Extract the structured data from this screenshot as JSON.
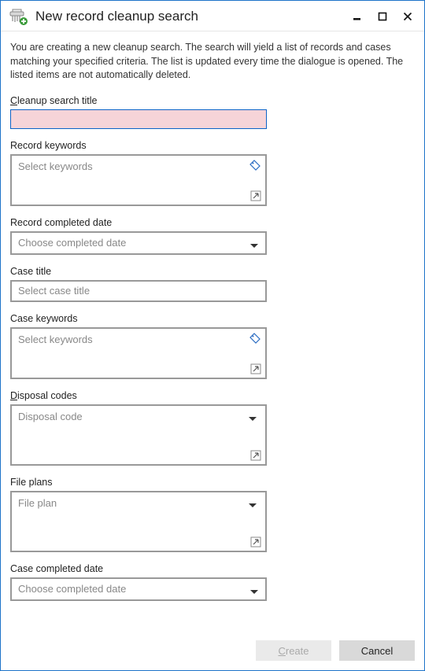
{
  "window": {
    "title": "New record cleanup search"
  },
  "description": "You are creating a new cleanup search. The search will yield a list of records and cases matching your specified criteria. The list is updated every time the dialogue is opened. The listed items are not automatically deleted.",
  "labels": {
    "cleanup_title_pre": "C",
    "cleanup_title_rest": "leanup search title",
    "record_keywords": "Record keywords",
    "record_completed": "Record completed date",
    "case_title": "Case title",
    "case_keywords": "Case keywords",
    "disposal_pre": "D",
    "disposal_rest": "isposal codes",
    "file_plans": "File plans",
    "case_completed": "Case completed date"
  },
  "placeholders": {
    "select_keywords": "Select keywords",
    "choose_completed": "Choose completed date",
    "select_case_title": "Select case title",
    "disposal_code": "Disposal code",
    "file_plan": "File plan"
  },
  "buttons": {
    "create_pre": "C",
    "create_rest": "reate",
    "cancel": "Cancel"
  }
}
